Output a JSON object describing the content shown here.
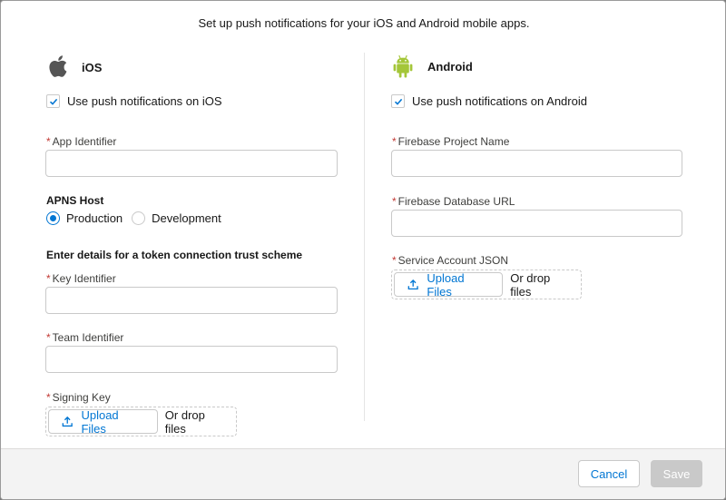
{
  "intro_text": "Set up push notifications for your iOS and Android mobile apps.",
  "ios": {
    "title": "iOS",
    "icon": "apple-icon",
    "enable_label": "Use push notifications on iOS",
    "enable_checked": true,
    "app_identifier": {
      "label": "App Identifier",
      "required": true,
      "value": ""
    },
    "apns_host": {
      "label": "APNS Host",
      "options": [
        "Production",
        "Development"
      ],
      "selected": "Production"
    },
    "token_scheme_heading": "Enter details for a token connection trust scheme",
    "key_identifier": {
      "label": "Key Identifier",
      "required": true,
      "value": ""
    },
    "team_identifier": {
      "label": "Team Identifier",
      "required": true,
      "value": ""
    },
    "signing_key": {
      "label": "Signing Key",
      "required": true,
      "upload_label": "Upload Files",
      "drop_label": "Or drop files"
    }
  },
  "android": {
    "title": "Android",
    "icon": "android-icon",
    "icon_color": "#a4c639",
    "enable_label": "Use push notifications on Android",
    "enable_checked": true,
    "firebase_project_name": {
      "label": "Firebase Project Name",
      "required": true,
      "value": ""
    },
    "firebase_database_url": {
      "label": "Firebase Database URL",
      "required": true,
      "value": ""
    },
    "service_account_json": {
      "label": "Service Account JSON",
      "required": true,
      "upload_label": "Upload Files",
      "drop_label": "Or drop files"
    }
  },
  "footer": {
    "cancel_label": "Cancel",
    "save_label": "Save",
    "save_disabled": true
  },
  "colors": {
    "brand": "#0176d3",
    "required": "#c23934",
    "disabled": "#c9c9c9"
  }
}
